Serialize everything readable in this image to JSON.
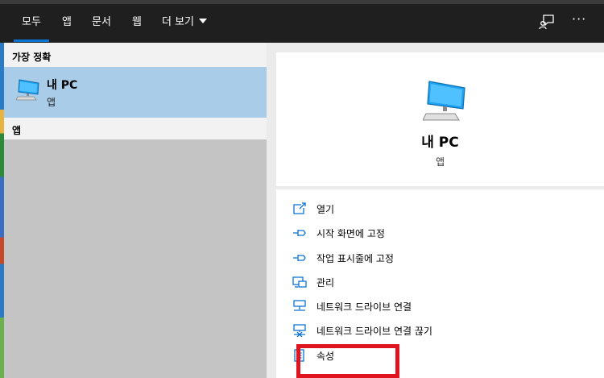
{
  "tabs": [
    {
      "label": "모두",
      "active": true
    },
    {
      "label": "앱"
    },
    {
      "label": "문서"
    },
    {
      "label": "웹"
    },
    {
      "label": "더 보기"
    }
  ],
  "header_icons": [
    "feedback-icon",
    "more-options-icon"
  ],
  "more_options_glyph": "···",
  "left": {
    "best_match_header": "가장 정확",
    "best_match": {
      "title": "내 PC",
      "subtitle": "앱",
      "icon": "computer-icon"
    },
    "apps_header": "앱"
  },
  "preview": {
    "title": "내 PC",
    "subtitle": "앱",
    "icon": "computer-icon"
  },
  "actions": [
    {
      "label": "열기",
      "icon": "open-icon"
    },
    {
      "label": "시작 화면에 고정",
      "icon": "pin-icon"
    },
    {
      "label": "작업 표시줄에 고정",
      "icon": "pin-icon"
    },
    {
      "label": "관리",
      "icon": "manage-icon"
    },
    {
      "label": "네트워크 드라이브 연결",
      "icon": "map-network-drive-icon"
    },
    {
      "label": "네트워크 드라이브 연결 끊기",
      "icon": "disconnect-network-drive-icon"
    },
    {
      "label": "속성",
      "icon": "properties-icon"
    }
  ],
  "colors": {
    "accent": "#0a74d6",
    "selected": "#a9cde9",
    "highlight": "#e0141e",
    "topbar": "#1f1f1f"
  }
}
